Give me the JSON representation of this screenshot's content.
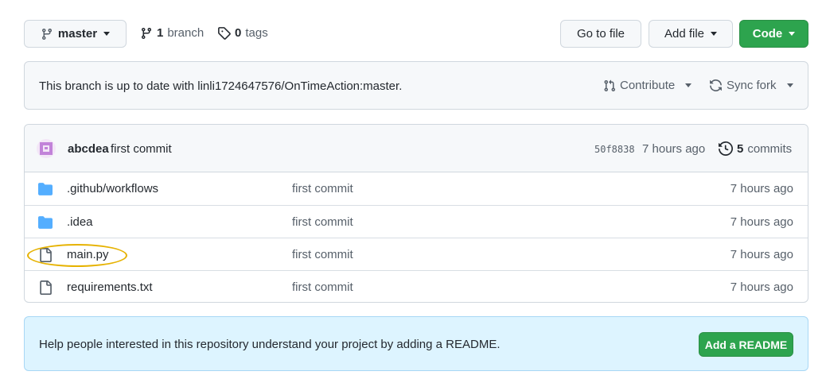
{
  "toolbar": {
    "branch_select": "master",
    "branches_count": "1",
    "branches_label": "branch",
    "tags_count": "0",
    "tags_label": "tags",
    "go_to_file": "Go to file",
    "add_file": "Add file",
    "code": "Code"
  },
  "sync": {
    "status_text": "This branch is up to date with linli1724647576/OnTimeAction:master.",
    "contribute_label": "Contribute",
    "sync_fork_label": "Sync fork"
  },
  "latest_commit": {
    "author": "abcdea",
    "message": "first commit",
    "sha": "50f8838",
    "age": "7 hours ago",
    "commits_count": "5",
    "commits_label": "commits"
  },
  "files": [
    {
      "name": ".github/workflows",
      "type": "folder",
      "message": "first commit",
      "age": "7 hours ago"
    },
    {
      "name": ".idea",
      "type": "folder",
      "message": "first commit",
      "age": "7 hours ago"
    },
    {
      "name": "main.py",
      "type": "file",
      "message": "first commit",
      "age": "7 hours ago"
    },
    {
      "name": "requirements.txt",
      "type": "file",
      "message": "first commit",
      "age": "7 hours ago"
    }
  ],
  "readme": {
    "prompt_text": "Help people interested in this repository understand your project by adding a README.",
    "button_label": "Add a README"
  },
  "colors": {
    "primary_green": "#2da44e",
    "folder_blue": "#54aeff",
    "highlight_ring": "#e6b200",
    "readme_bg": "#ddf4ff"
  }
}
